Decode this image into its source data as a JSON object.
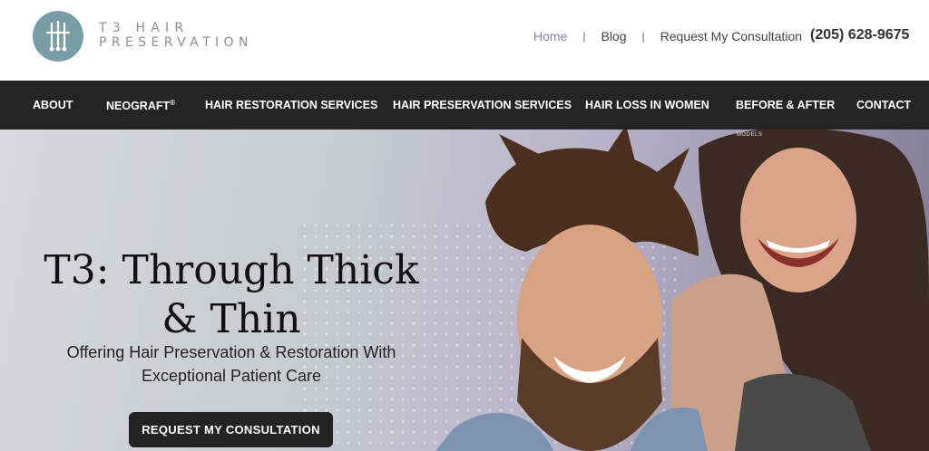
{
  "brand": {
    "line1": "T3 HAIR",
    "line2": "PRESERVATION",
    "logo_icon": "hair-follicle-icon"
  },
  "top_links": [
    {
      "label": "Home",
      "active": true
    },
    {
      "label": "Blog"
    },
    {
      "label": "Request My Consultation"
    }
  ],
  "separator": "|",
  "phone": "(205) 628-9675",
  "nav": {
    "about": "ABOUT",
    "neograft": "NEOGRAFT",
    "neograft_mark": "®",
    "restoration": "HAIR RESTORATION SERVICES",
    "preservation": "HAIR PRESERVATION SERVICES",
    "women": "HAIR LOSS IN WOMEN",
    "before_after": "BEFORE & AFTER",
    "contact": "CONTACT"
  },
  "hero": {
    "models_note": "MODELS",
    "title_line1": "T3: Through Thick",
    "title_line2": "& Thin",
    "subtitle_line1": "Offering Hair Preservation & Restoration With",
    "subtitle_line2": "Exceptional Patient Care",
    "cta": "REQUEST MY CONSULTATION"
  },
  "colors": {
    "nav_bg": "#242424",
    "active_link": "#8c7cb0",
    "logo": "#7a9ea6",
    "button": "#232323"
  }
}
